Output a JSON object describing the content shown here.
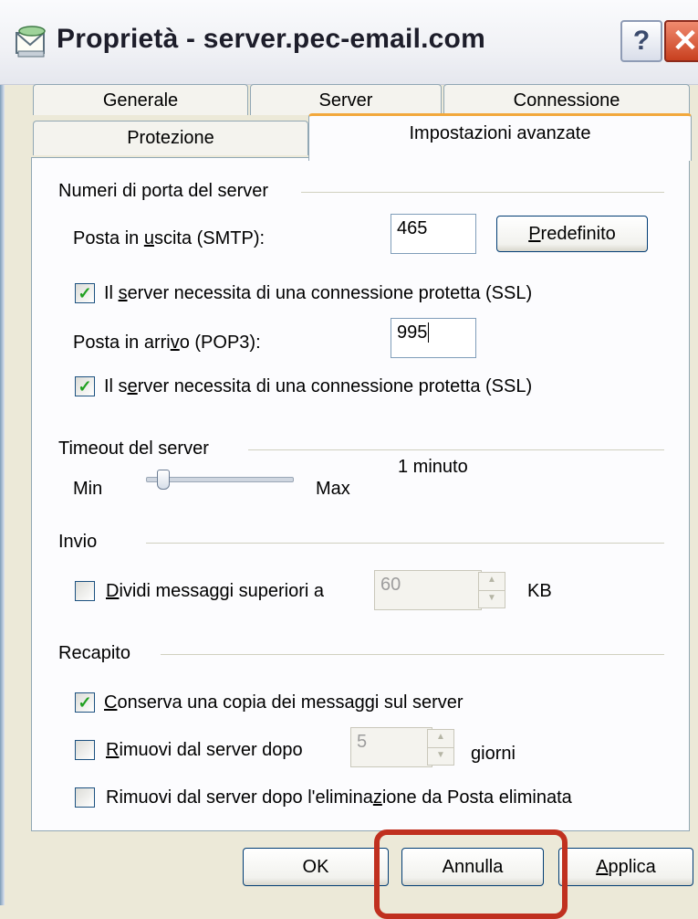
{
  "window": {
    "title": "Proprietà - server.pec-email.com",
    "help_label": "?",
    "close_label": "✕"
  },
  "tabs": {
    "back_row": [
      "Generale",
      "Server",
      "Connessione"
    ],
    "front_row": [
      "Protezione",
      "Impostazioni avanzate"
    ],
    "active": "Impostazioni avanzate"
  },
  "ports": {
    "group_label": "Numeri di porta del server",
    "smtp_label": "Posta in uscita (SMTP):",
    "smtp_value": "465",
    "default_button": "Predefinito",
    "ssl_smtp_label": "Il server necessita di una connessione protetta (SSL)",
    "ssl_smtp_checked": true,
    "pop3_label": "Posta in arrivo (POP3):",
    "pop3_value": "995",
    "ssl_pop3_label": "Il server necessita di una connessione protetta (SSL)",
    "ssl_pop3_checked": true
  },
  "timeout": {
    "group_label": "Timeout del server",
    "min_label": "Min",
    "max_label": "Max",
    "value_label": "1 minuto",
    "slider_fraction": 0.12
  },
  "sending": {
    "group_label": "Invio",
    "split_label": "Dividi messaggi superiori a",
    "split_checked": false,
    "split_value": "60",
    "split_unit": "KB"
  },
  "delivery": {
    "group_label": "Recapito",
    "keep_copy_label": "Conserva una copia dei messaggi sul server",
    "keep_copy_checked": true,
    "remove_after_label": "Rimuovi dal server dopo",
    "remove_after_checked": false,
    "remove_after_value": "5",
    "remove_after_unit": "giorni",
    "remove_on_delete_label": "Rimuovi dal server dopo l'eliminazione da Posta eliminata",
    "remove_on_delete_checked": false
  },
  "footer": {
    "ok": "OK",
    "cancel": "Annulla",
    "apply": "Applica"
  },
  "colors": {
    "highlight": "#c0301f",
    "tab_accent": "#f2a83c",
    "check_mark": "#21a121"
  }
}
